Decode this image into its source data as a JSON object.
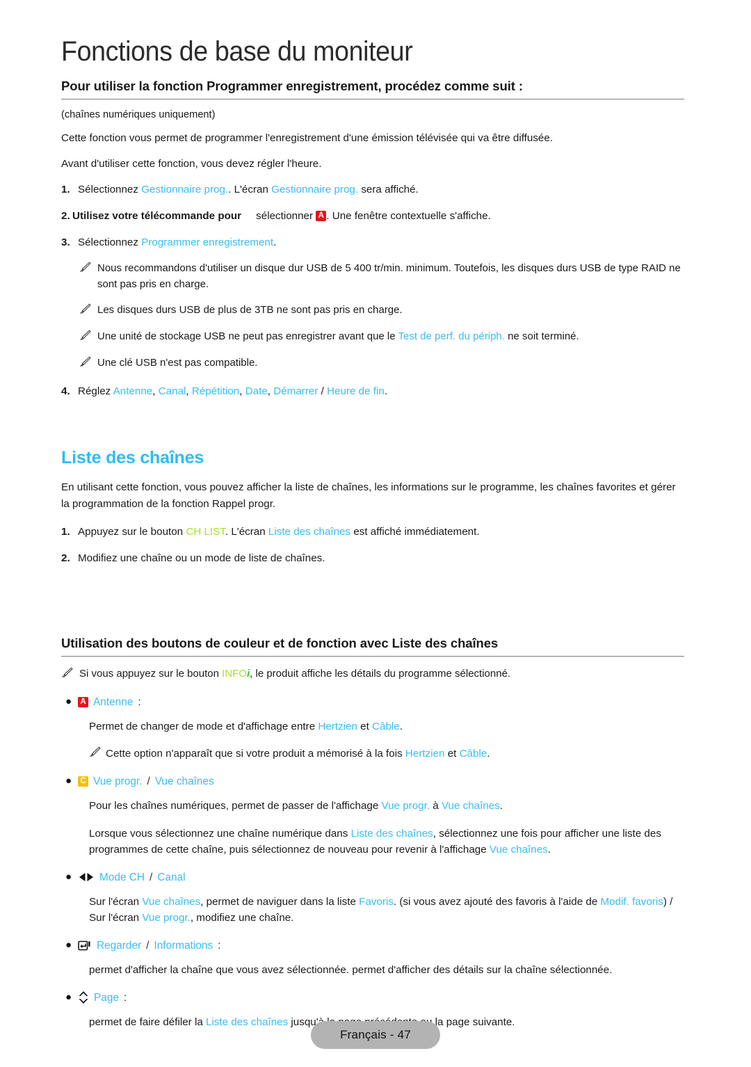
{
  "document": {
    "chapter_title": "Fonctions de base du moniteur",
    "footer_label": "Français - 47"
  },
  "colors": {
    "cyan_link": "#39bdf3",
    "green_key": "#a7e02c",
    "green_i": "#3fbf3f",
    "key_a_bg": "#e8141b",
    "key_c_bg": "#f5c010",
    "footer_pill_bg": "#b3b3b3"
  },
  "section_schedule": {
    "heading": "Pour utiliser la fonction Programmer enregistrement, procédez comme suit :",
    "note_digital_only": "(chaînes numériques uniquement)",
    "intro_1": "Cette fonction vous permet de programmer l'enregistrement d'une émission télévisée qui va être diffusée.",
    "intro_2": "Avant d'utiliser cette fonction, vous devez régler l'heure.",
    "steps": [
      {
        "num": "1.",
        "p1": "Sélectionnez ",
        "link1": "Gestionnaire prog.",
        "p2": ". L'écran ",
        "link2": "Gestionnaire prog.",
        "p3": " sera affiché."
      },
      {
        "num": "2.",
        "bold_text": "Utilisez votre télécommande pour",
        "p1": "sélectionner ",
        "key": "A",
        "p2": ". Une fenêtre contextuelle s'affiche."
      },
      {
        "num": "3.",
        "p1": "Sélectionnez ",
        "link1": "Programmer enregistrement",
        "p2": "."
      }
    ],
    "notes": [
      "Nous recommandons d'utiliser un disque dur USB de 5 400 tr/min. minimum. Toutefois, les disques durs USB de type RAID ne sont pas pris en charge.",
      "Les disques durs USB de plus de 3TB ne sont pas pris en charge."
    ],
    "note_usb_test": {
      "p1": "Une unité de stockage USB ne peut pas enregistrer avant que le ",
      "link": "Test de perf. du périph.",
      "p2": " ne soit terminé."
    },
    "note_usb_key": "Une clé USB n'est pas compatible.",
    "step4": {
      "num": "4.",
      "p1": "Réglez ",
      "link_antenne": "Antenne",
      "s1": ", ",
      "link_canal": "Canal",
      "s2": ", ",
      "link_repetition": "Répétition",
      "s3": ", ",
      "link_date": "Date",
      "s4": ", ",
      "link_demarrer": "Démarrer",
      "s5": " / ",
      "link_heure_fin": "Heure de fin",
      "s6": "."
    }
  },
  "section_channel_list": {
    "heading": "Liste des chaînes",
    "intro": "En utilisant cette fonction, vous pouvez afficher la liste de chaînes, les informations sur le programme, les chaînes favorites et gérer la programmation de la fonction Rappel progr.",
    "steps": [
      {
        "num": "1.",
        "p1": "Appuyez sur le bouton ",
        "key_label": "CH LIST",
        "p2": ". L'écran ",
        "link": "Liste des chaînes",
        "p3": " est affiché immédiatement."
      },
      {
        "num": "2.",
        "p1": "Modifiez une chaîne ou un mode de liste de chaînes."
      }
    ]
  },
  "section_buttons": {
    "heading": "Utilisation des boutons de couleur et de fonction avec Liste des chaînes",
    "info_note": {
      "p1": "Si vous appuyez sur le bouton ",
      "key_label": "INFO",
      "key_suffix": "i",
      "p2": ", le produit affiche les détails du programme sélectionné."
    },
    "items": [
      {
        "icon": "key-a-badge",
        "key": "A",
        "label": "Antenne",
        "colon": ":",
        "desc_parts": {
          "p1": "Permet de changer de mode et d'affichage entre ",
          "l1": "Hertzien",
          "p2": " et ",
          "l2": "Câble",
          "p3": "."
        },
        "sub_note": {
          "p1": "Cette option n'apparaît que si votre produit a mémorisé à la fois ",
          "l1": "Hertzien",
          "p2": " et ",
          "l2": "Câble",
          "p3": "."
        }
      },
      {
        "icon": "key-c-badge",
        "key": "C",
        "label_a": "Vue progr.",
        "slash": "/",
        "label_b": "Vue chaînes",
        "desc_parts": {
          "p1": "Pour les chaînes numériques, permet de passer de l'affichage ",
          "l1": "Vue progr.",
          "p2": " à ",
          "l2": "Vue chaînes",
          "p3": "."
        },
        "desc2_parts": {
          "p1": "Lorsque vous sélectionnez une chaîne numérique dans ",
          "l1": "Liste des chaînes",
          "p2": ", sélectionnez une fois pour afficher une liste des programmes de cette chaîne, puis sélectionnez de nouveau pour revenir à l'affichage ",
          "l2": "Vue chaînes",
          "p3": "."
        }
      },
      {
        "icon": "left-right-arrows-icon",
        "label_a": "Mode CH",
        "slash": "/",
        "label_b": "Canal",
        "desc_parts": {
          "p1": "Sur l'écran ",
          "l1": "Vue chaînes",
          "p2": ", permet de naviguer dans la liste ",
          "l2": "Favoris",
          "p3": ". (si vous avez ajouté des favoris à l'aide de ",
          "l3": "Modif. favoris",
          "p4": ") / Sur l'écran ",
          "l4": "Vue progr.",
          "p5": ", modifiez une chaîne."
        }
      },
      {
        "icon": "enter-key-icon",
        "label_a": "Regarder",
        "slash": "/",
        "label_b": "Informations",
        "colon": ":",
        "desc": "permet d'afficher la chaîne que vous avez sélectionnée. permet d'afficher des détails sur la chaîne sélectionnée."
      },
      {
        "icon": "up-down-arrows-icon",
        "label_a": "Page",
        "colon": ":",
        "desc_parts": {
          "p1": "permet de faire défiler la ",
          "l1": "Liste des chaînes",
          "p2": " jusqu'à la page précédente ou la page suivante."
        }
      }
    ]
  }
}
